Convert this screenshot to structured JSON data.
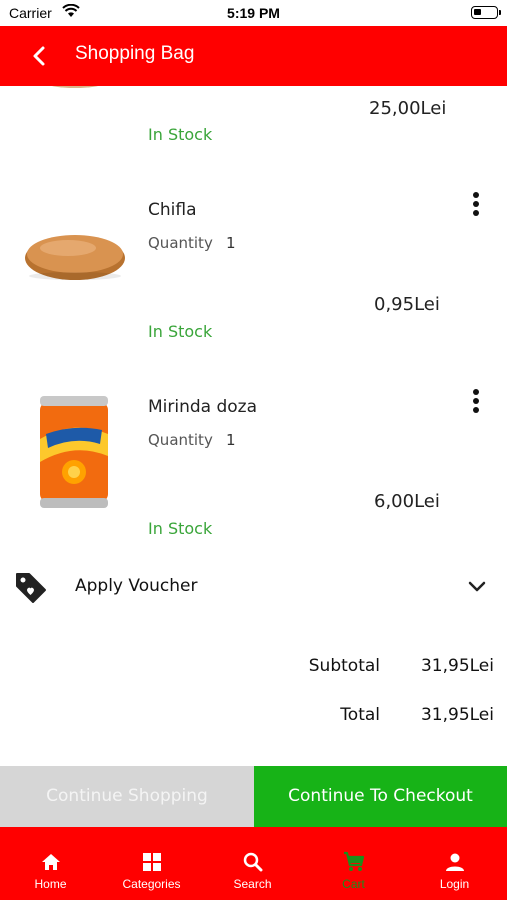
{
  "status_bar": {
    "carrier": "Carrier",
    "time": "5:19 PM"
  },
  "header": {
    "title": "Shopping Bag"
  },
  "items": [
    {
      "name": "",
      "price": "25,00Lei",
      "stock": "In Stock"
    },
    {
      "name": "Chifla",
      "quantity_label": "Quantity",
      "quantity": "1",
      "price": "0,95Lei",
      "stock": "In Stock"
    },
    {
      "name": "Mirinda doza",
      "quantity_label": "Quantity",
      "quantity": "1",
      "price": "6,00Lei",
      "stock": "In Stock"
    }
  ],
  "voucher": {
    "label": "Apply Voucher"
  },
  "summary": {
    "subtotal_label": "Subtotal",
    "subtotal": "31,95Lei",
    "total_label": "Total",
    "total": "31,95Lei"
  },
  "actions": {
    "continue_shopping": "Continue Shopping",
    "checkout": "Continue To Checkout"
  },
  "nav": [
    {
      "label": "Home",
      "icon": "home-icon"
    },
    {
      "label": "Categories",
      "icon": "grid-icon"
    },
    {
      "label": "Search",
      "icon": "search-icon"
    },
    {
      "label": "Cart",
      "icon": "cart-icon",
      "active": true
    },
    {
      "label": "Login",
      "icon": "person-icon"
    }
  ],
  "colors": {
    "brand_red": "#ff0000",
    "checkout_green": "#17b317",
    "stock_green": "#3aa53a",
    "disabled_grey": "#d6d6d6"
  }
}
